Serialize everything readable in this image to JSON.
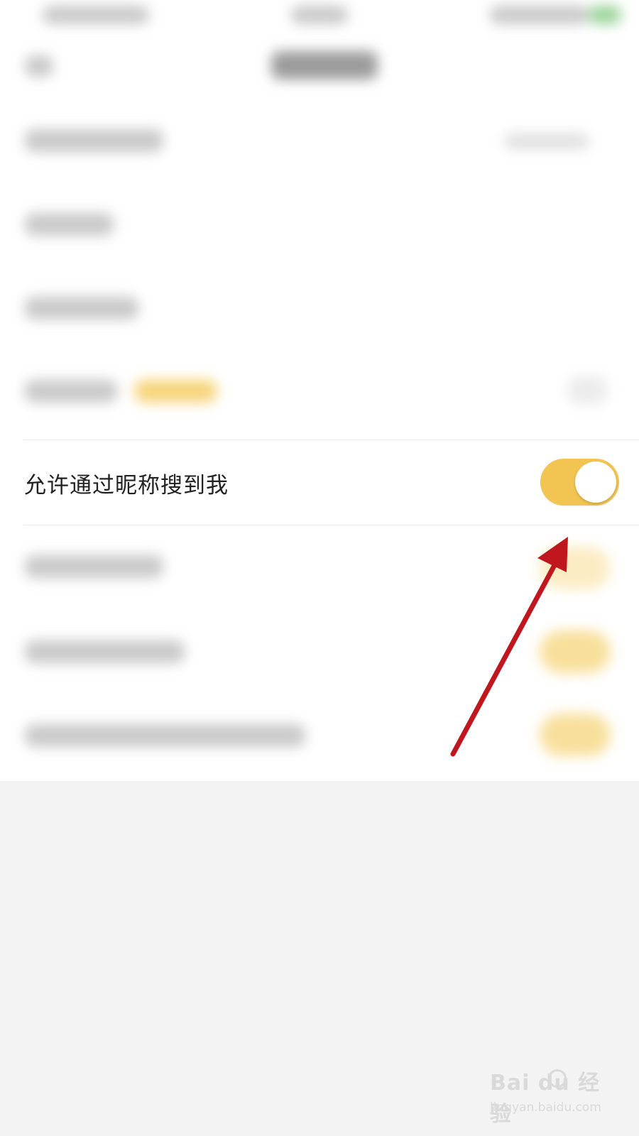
{
  "settings": {
    "search_by_nickname": {
      "label": "允许通过昵称搜到我",
      "enabled": true,
      "toggle_color": "#f2c552"
    }
  },
  "annotation": {
    "arrow_color": "#c0161d"
  },
  "watermark": {
    "logo_text": "Bai  du 经验",
    "url": "jingyan.baidu.com"
  }
}
